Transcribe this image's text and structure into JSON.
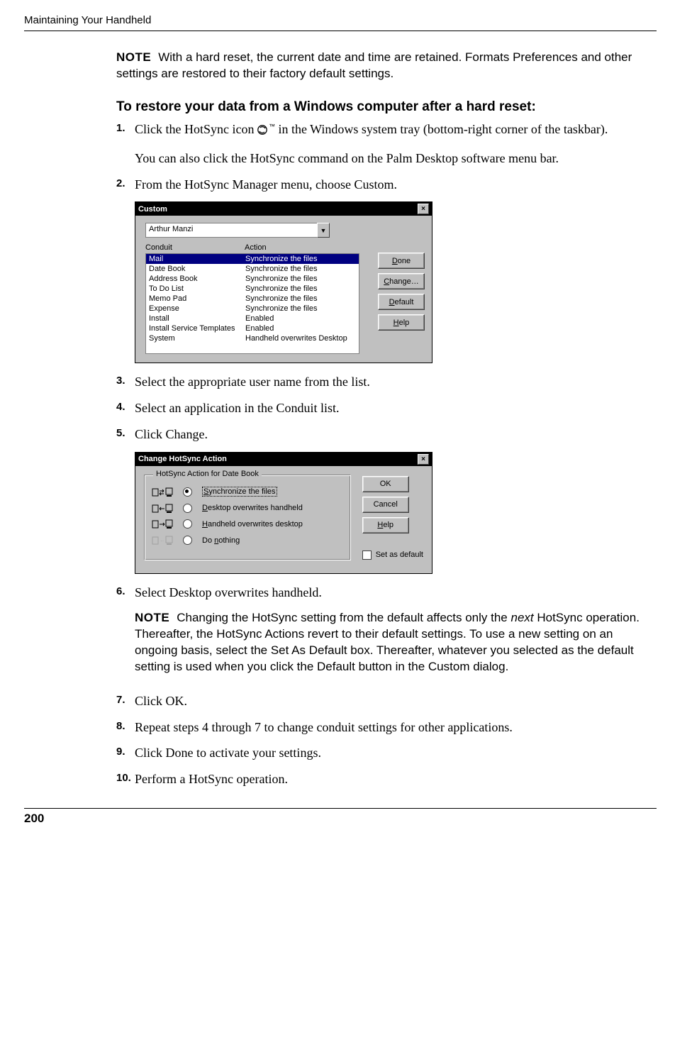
{
  "header": {
    "running_head": "Maintaining Your Handheld"
  },
  "note1": {
    "label": "NOTE",
    "text": "With a hard reset, the current date and time are retained. Formats Preferences and other settings are restored to their factory default settings."
  },
  "section_head": "To restore your data from a Windows computer after a hard reset:",
  "steps": {
    "s1_num": "1.",
    "s1a": "Click the HotSync icon ",
    "s1b": " in the Windows system tray (bottom-right corner of the taskbar).",
    "s1_sub": "You can also click the HotSync command on the Palm Desktop software menu bar.",
    "s2_num": "2.",
    "s2": "From the HotSync Manager menu, choose Custom.",
    "s3_num": "3.",
    "s3": "Select the appropriate user name from the list.",
    "s4_num": "4.",
    "s4": "Select an application in the Conduit list.",
    "s5_num": "5.",
    "s5": "Click Change.",
    "s6_num": "6.",
    "s6": "Select Desktop overwrites handheld.",
    "s7_num": "7.",
    "s7": "Click OK.",
    "s8_num": "8.",
    "s8": "Repeat steps 4 through 7 to change conduit settings for other applications.",
    "s9_num": "9.",
    "s9": "Click Done to activate your settings.",
    "s10_num": "10.",
    "s10": "Perform a HotSync operation."
  },
  "note2": {
    "label": "NOTE",
    "pre": "Changing the HotSync setting from the default affects only the ",
    "em": "next",
    "post": " HotSync operation. Thereafter, the HotSync Actions revert to their default settings. To use a new setting on an ongoing basis, select the Set As Default box. Thereafter, whatever you selected as the default setting is used when you click the Default button in the Custom dialog."
  },
  "dlg_custom": {
    "title": "Custom",
    "user": "Arthur Manzi",
    "col_conduit": "Conduit",
    "col_action": "Action",
    "rows": [
      {
        "c": "Mail",
        "a": "Synchronize the files",
        "sel": true
      },
      {
        "c": "Date Book",
        "a": "Synchronize the files"
      },
      {
        "c": "Address Book",
        "a": "Synchronize the files"
      },
      {
        "c": "To Do List",
        "a": "Synchronize the files"
      },
      {
        "c": "Memo Pad",
        "a": "Synchronize the files"
      },
      {
        "c": "Expense",
        "a": "Synchronize the files"
      },
      {
        "c": "Install",
        "a": "Enabled"
      },
      {
        "c": "Install Service Templates",
        "a": "Enabled"
      },
      {
        "c": "System",
        "a": "Handheld overwrites Desktop"
      }
    ],
    "btn_done_u": "D",
    "btn_done_r": "one",
    "btn_change_u": "C",
    "btn_change_r": "hange…",
    "btn_default_u": "D",
    "btn_default_r": "efault",
    "btn_help_u": "H",
    "btn_help_r": "elp"
  },
  "dlg_change": {
    "title": "Change HotSync Action",
    "group": "HotSync Action for Date Book",
    "opt1_u": "S",
    "opt1_r": "ynchronize the files",
    "opt2_u": "D",
    "opt2_r": "esktop overwrites handheld",
    "opt3_u": "H",
    "opt3_r": "andheld overwrites desktop",
    "opt4_pre": "Do ",
    "opt4_u": "n",
    "opt4_r": "othing",
    "btn_ok": "OK",
    "btn_cancel": "Cancel",
    "btn_help_u": "H",
    "btn_help_r": "elp",
    "chk_pre": "Set ",
    "chk_u": "a",
    "chk_r": "s default"
  },
  "pagenum": "200"
}
